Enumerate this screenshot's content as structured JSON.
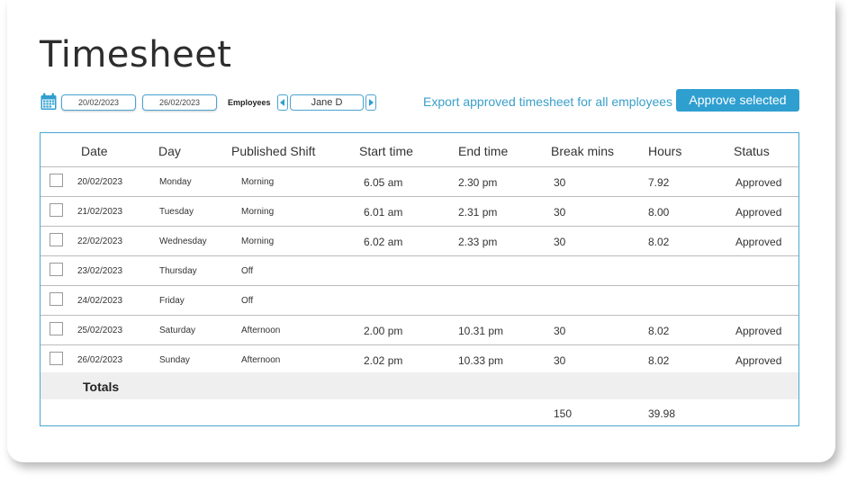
{
  "page": {
    "title": "Timesheet"
  },
  "toolbar": {
    "date_from": "20/02/2023",
    "date_to": "26/02/2023",
    "employees_label": "Employees",
    "employee_value": "Jane D",
    "export_link": "Export approved timesheet for all employees",
    "approve_button": "Approve selected"
  },
  "icons": {
    "calendar": "calendar-icon",
    "prev": "triangle-left-icon",
    "next": "triangle-right-icon"
  },
  "colors": {
    "accent": "#2f9fd0",
    "border": "#49a6d0",
    "totals_bg": "#efefef"
  },
  "table": {
    "headers": [
      "Date",
      "Day",
      "Published Shift",
      "Start time",
      "End time",
      "Break mins",
      "Hours",
      "Status"
    ],
    "rows": [
      {
        "date": "20/02/2023",
        "day": "Monday",
        "shift": "Morning",
        "start": "6.05 am",
        "end": "2.30 pm",
        "break": "30",
        "hours": "7.92",
        "status": "Approved"
      },
      {
        "date": "21/02/2023",
        "day": "Tuesday",
        "shift": "Morning",
        "start": "6.01 am",
        "end": "2.31 pm",
        "break": "30",
        "hours": "8.00",
        "status": "Approved"
      },
      {
        "date": "22/02/2023",
        "day": "Wednesday",
        "shift": "Morning",
        "start": "6.02 am",
        "end": "2.33 pm",
        "break": "30",
        "hours": "8.02",
        "status": "Approved"
      },
      {
        "date": "23/02/2023",
        "day": "Thursday",
        "shift": "Off",
        "start": "",
        "end": "",
        "break": "",
        "hours": "",
        "status": ""
      },
      {
        "date": "24/02/2023",
        "day": "Friday",
        "shift": "Off",
        "start": "",
        "end": "",
        "break": "",
        "hours": "",
        "status": ""
      },
      {
        "date": "25/02/2023",
        "day": "Saturday",
        "shift": "Afternoon",
        "start": "2.00 pm",
        "end": "10.31 pm",
        "break": "30",
        "hours": "8.02",
        "status": "Approved"
      },
      {
        "date": "26/02/2023",
        "day": "Sunday",
        "shift": "Afternoon",
        "start": "2.02 pm",
        "end": "10.33 pm",
        "break": "30",
        "hours": "8.02",
        "status": "Approved"
      }
    ],
    "totals": {
      "label": "Totals",
      "break": "150",
      "hours": "39.98"
    }
  }
}
